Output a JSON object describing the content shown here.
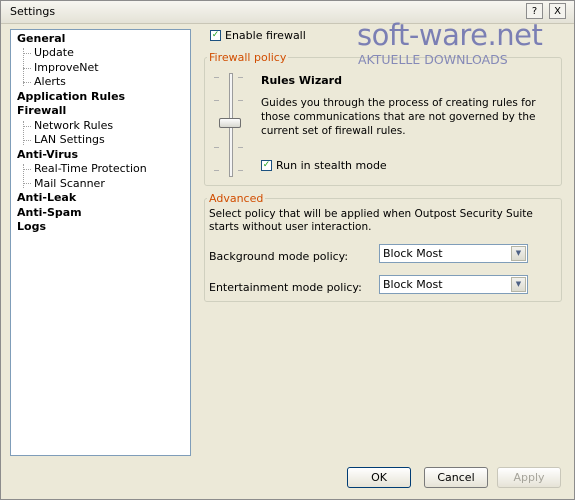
{
  "window": {
    "title": "Settings",
    "help_label": "?",
    "close_label": "X"
  },
  "tree": {
    "items": [
      {
        "label": "General",
        "level": 0
      },
      {
        "label": "Update",
        "level": 1
      },
      {
        "label": "ImproveNet",
        "level": 1
      },
      {
        "label": "Alerts",
        "level": 1
      },
      {
        "label": "Application Rules",
        "level": 0
      },
      {
        "label": "Firewall",
        "level": 0
      },
      {
        "label": "Network Rules",
        "level": 1
      },
      {
        "label": "LAN Settings",
        "level": 1
      },
      {
        "label": "Anti-Virus",
        "level": 0
      },
      {
        "label": "Real-Time Protection",
        "level": 1
      },
      {
        "label": "Mail Scanner",
        "level": 1
      },
      {
        "label": "Anti-Leak",
        "level": 0
      },
      {
        "label": "Anti-Spam",
        "level": 0
      },
      {
        "label": "Logs",
        "level": 0
      }
    ]
  },
  "enable_firewall": {
    "label": "Enable firewall",
    "checked": true
  },
  "firewall_policy": {
    "title": "Firewall policy",
    "policy_name": "Rules Wizard",
    "description": "Guides you through the process of creating rules for those communications that are not governed by the current set of firewall rules.",
    "stealth_label": "Run in stealth mode",
    "stealth_checked": true,
    "slider_level": "Rules Wizard"
  },
  "advanced": {
    "title": "Advanced",
    "description": "Select policy that will be applied when Outpost Security Suite starts without user interaction.",
    "background_label": "Background mode policy:",
    "background_value": "Block Most",
    "entertainment_label": "Entertainment mode policy:",
    "entertainment_value": "Block Most"
  },
  "buttons": {
    "ok": "OK",
    "cancel": "Cancel",
    "apply": "Apply"
  },
  "watermark": {
    "main": "soft-ware.net",
    "sub": "AKTUELLE DOWNLOADS"
  },
  "colors": {
    "group_title": "#d14d00",
    "watermark": "#7b7fb4",
    "checkmark": "#21a121"
  }
}
